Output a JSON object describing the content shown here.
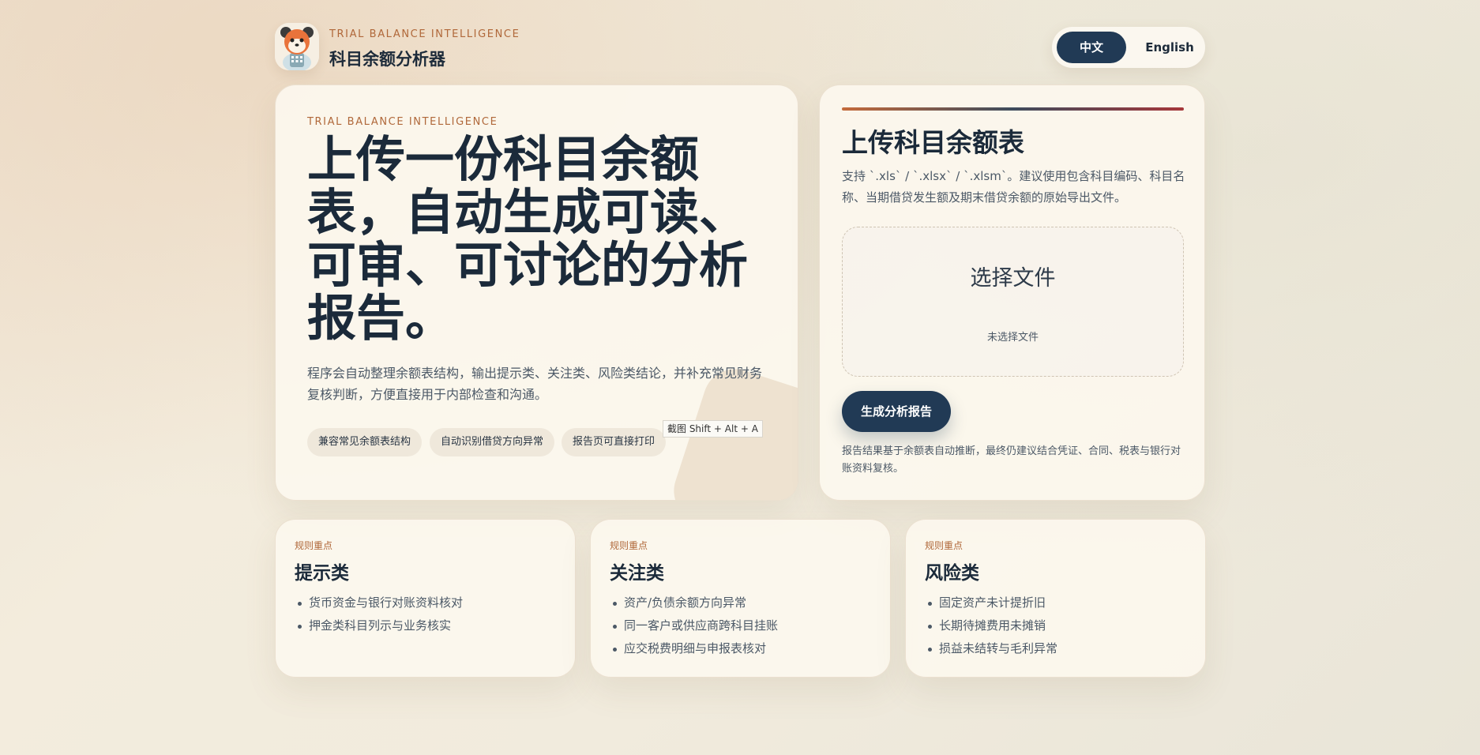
{
  "brand": {
    "kicker": "TRIAL BALANCE INTELLIGENCE",
    "title": "科目余额分析器",
    "logo_icon": "panda-mascot-icon"
  },
  "language": {
    "options": [
      "中文",
      "English"
    ],
    "selected": "中文"
  },
  "hero": {
    "kicker": "TRIAL BALANCE INTELLIGENCE",
    "title": "上传一份科目余额表，自动生成可读、可审、可讨论的分析报告。",
    "description": "程序会自动整理余额表结构，输出提示类、关注类、风险类结论，并补充常见财务复核判断，方便直接用于内部检查和沟通。",
    "chips": [
      "兼容常见余额表结构",
      "自动识别借贷方向异常",
      "报告页可直接打印"
    ],
    "tooltip": "截图 Shift + Alt + A"
  },
  "upload": {
    "title": "上传科目余额表",
    "description": "支持 `.xls` / `.xlsx` / `.xlsm`。建议使用包含科目编码、科目名称、当期借贷发生额及期末借贷余额的原始导出文件。",
    "choose_label": "选择文件",
    "file_status": "未选择文件",
    "submit_label": "生成分析报告",
    "note": "报告结果基于余额表自动推断，最终仍建议结合凭证、合同、税表与银行对账资料复核。"
  },
  "rules": [
    {
      "kicker": "规则重点",
      "title": "提示类",
      "items": [
        "货币资金与银行对账资料核对",
        "押金类科目列示与业务核实"
      ]
    },
    {
      "kicker": "规则重点",
      "title": "关注类",
      "items": [
        "资产/负债余额方向异常",
        "同一客户或供应商跨科目挂账",
        "应交税费明细与申报表核对"
      ]
    },
    {
      "kicker": "规则重点",
      "title": "风险类",
      "items": [
        "固定资产未计提折旧",
        "长期待摊费用未摊销",
        "损益未结转与毛利异常"
      ]
    }
  ],
  "colors": {
    "accent": "#b0683a",
    "primary": "#213a55",
    "text": "#1b2a3a"
  }
}
